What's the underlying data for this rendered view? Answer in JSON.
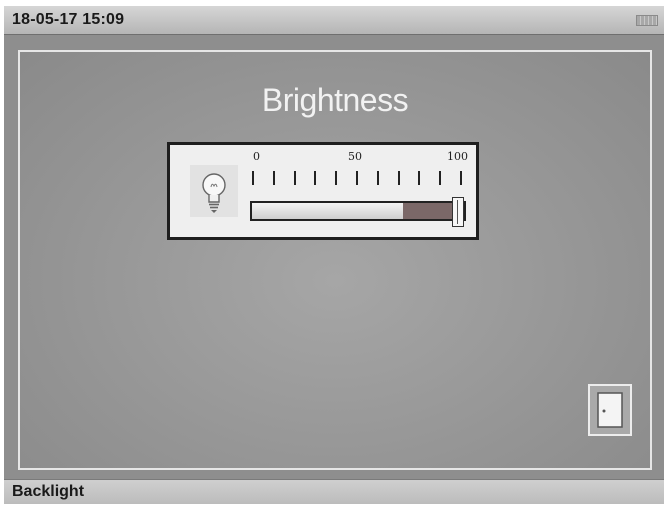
{
  "status_bar": {
    "datetime": "18-05-17 15:09",
    "battery_icon": "battery-icon"
  },
  "main": {
    "title": "Brightness",
    "brightness_control": {
      "icon": "light-bulb-icon",
      "scale_labels": [
        "0",
        "50",
        "100"
      ],
      "tick_count": 11,
      "value_percent": 97,
      "min": 0,
      "max": 100
    },
    "exit_button_icon": "door-icon"
  },
  "footer": {
    "screen_name": "Backlight"
  }
}
